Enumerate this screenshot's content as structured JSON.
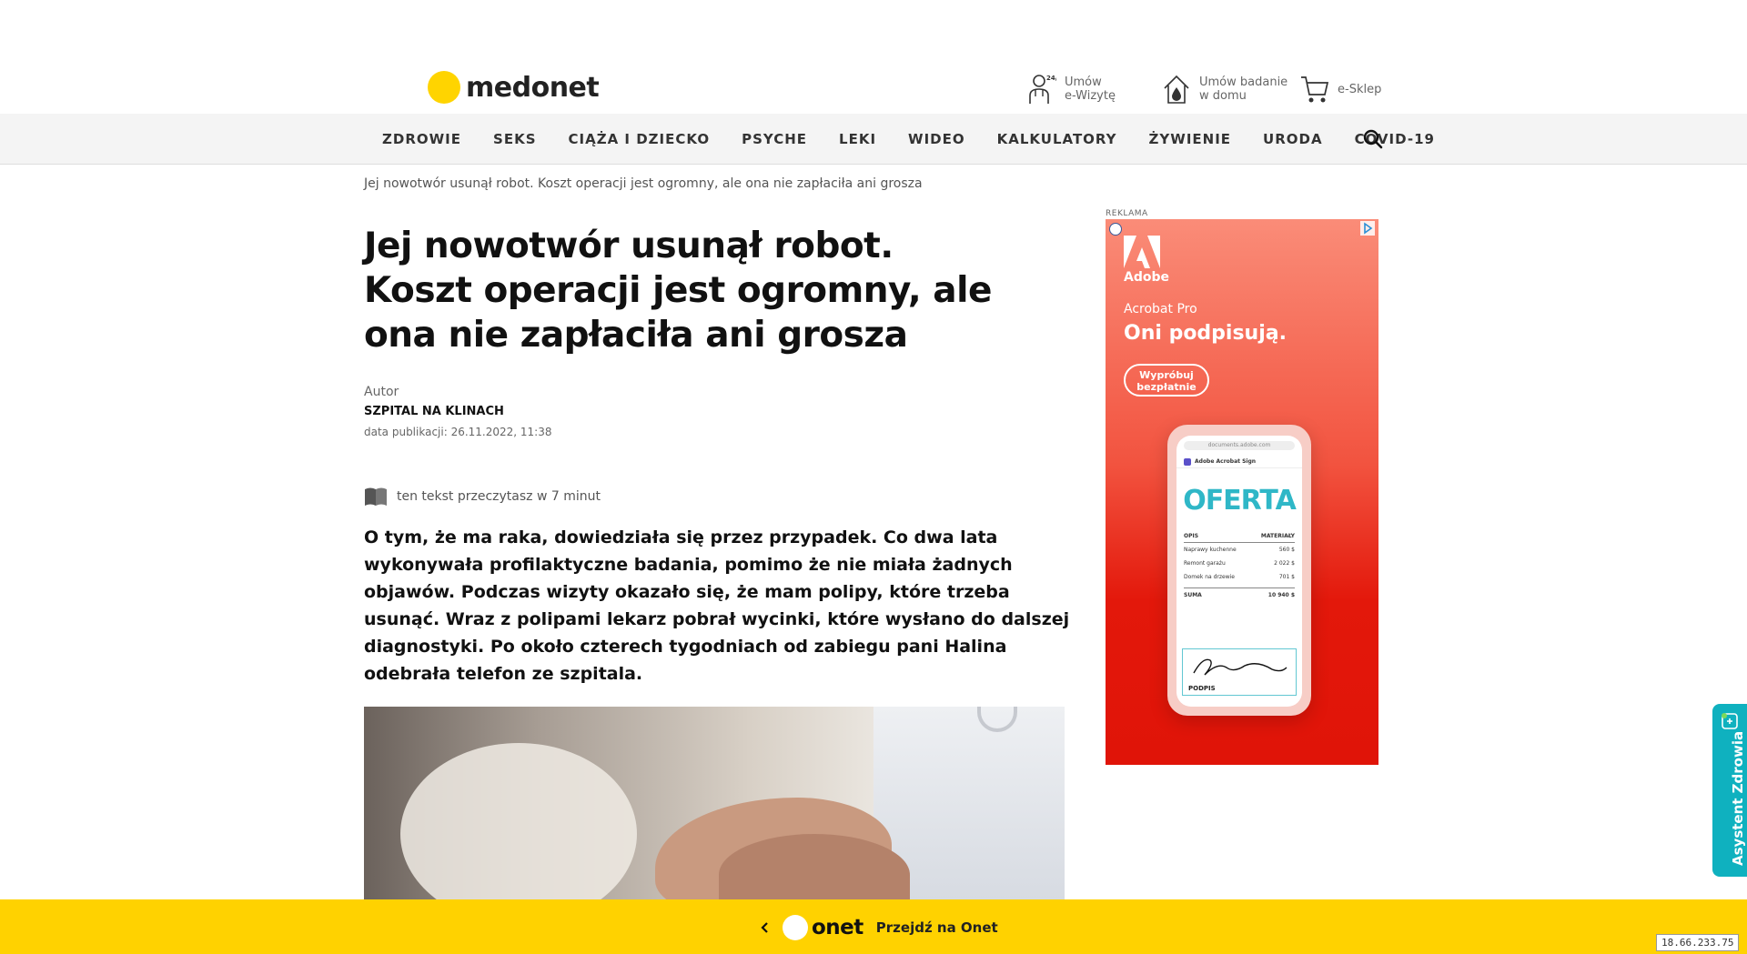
{
  "brand": {
    "name": "medonet",
    "dot_color": "#ffd400"
  },
  "utility": {
    "visit": {
      "line1": "Umów",
      "line2": "e-Wizytę",
      "badge": "24/7"
    },
    "exam": {
      "line1": "Umów badanie",
      "line2": "w domu"
    },
    "shop": {
      "label": "e-Sklep"
    }
  },
  "nav": {
    "items": [
      "ZDROWIE",
      "SEKS",
      "CIĄŻA I DZIECKO",
      "PSYCHE",
      "LEKI",
      "WIDEO",
      "KALKULATORY",
      "ŻYWIENIE",
      "URODA",
      "COVID-19"
    ],
    "search_icon": "search-icon"
  },
  "article": {
    "breadcrumb": "Jej nowotwór usunął robot. Koszt operacji jest ogromny, ale ona nie zapłaciła ani grosza",
    "title": "Jej nowotwór usunął robot. Koszt operacji jest ogromny, ale ona nie zapłaciła ani grosza",
    "author_label": "Autor",
    "author_name": "SZPITAL NA KLINACH",
    "pub_date": "data publikacji: 26.11.2022, 11:38",
    "reading_time": "ten tekst przeczytasz w 7 minut",
    "lead": "O tym, że ma raka, dowiedziała się przez przypadek. Co dwa lata wykonywała profilaktyczne badania, pomimo że nie miała żadnych objawów. Podczas wizyty okazało się, że mam polipy, które trzeba usunąć. Wraz z polipami lekarz pobrał wycinki, które wysłano do dalszej diagnostyki. Po około czterech tygodniach od zabiegu pani Halina odebrała telefon ze szpitala."
  },
  "ad": {
    "label": "REKLAMA",
    "brand": "Adobe",
    "product": "Acrobat Pro",
    "headline": "Oni podpisują.",
    "cta": "Wypróbuj bezpłatnie",
    "phone": {
      "url": "documents.adobe.com",
      "app": "Adobe Acrobat Sign",
      "doc_title": "OFERTA",
      "col1": "OPIS",
      "col2": "MATERIAŁY",
      "rows": [
        {
          "desc": "Naprawy kuchenne",
          "amount": "560 $"
        },
        {
          "desc": "Remont garażu",
          "amount": "2 022 $"
        },
        {
          "desc": "Domek na drzewie",
          "amount": "701 $"
        }
      ],
      "total_label": "SUMA",
      "total_value": "10 940 $",
      "sign_label": "PODPIS"
    }
  },
  "assistant": {
    "label": "Asystent Zdrowia",
    "color": "#0fb1bf"
  },
  "bottom_bar": {
    "brand": "onet",
    "cta": "Przejdź na Onet",
    "color": "#ffd200"
  },
  "ip": "18.66.233.75"
}
